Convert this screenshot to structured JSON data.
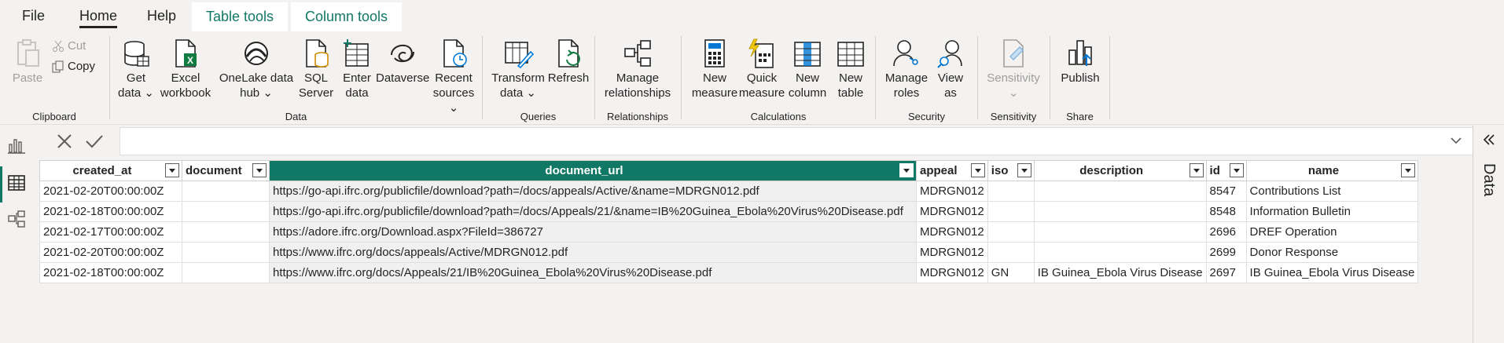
{
  "menu": {
    "file": "File",
    "home": "Home",
    "help": "Help",
    "table_tools": "Table tools",
    "column_tools": "Column tools"
  },
  "ribbon": {
    "clipboard": {
      "label": "Clipboard",
      "paste": "Paste",
      "cut": "Cut",
      "copy": "Copy"
    },
    "data": {
      "label": "Data",
      "get_data": [
        "Get",
        "data"
      ],
      "excel": [
        "Excel",
        "workbook"
      ],
      "onelake": [
        "OneLake data",
        "hub"
      ],
      "sql": [
        "SQL",
        "Server"
      ],
      "enter": [
        "Enter",
        "data"
      ],
      "dataverse": "Dataverse",
      "recent": [
        "Recent",
        "sources"
      ]
    },
    "queries": {
      "label": "Queries",
      "transform": [
        "Transform",
        "data"
      ],
      "refresh": "Refresh"
    },
    "relationships": {
      "label": "Relationships",
      "manage": [
        "Manage",
        "relationships"
      ]
    },
    "calculations": {
      "label": "Calculations",
      "new_measure": [
        "New",
        "measure"
      ],
      "quick_measure": [
        "Quick",
        "measure"
      ],
      "new_column": [
        "New",
        "column"
      ],
      "new_table": [
        "New",
        "table"
      ]
    },
    "security": {
      "label": "Security",
      "manage_roles": [
        "Manage",
        "roles"
      ],
      "view_as": [
        "View",
        "as"
      ]
    },
    "sensitivity": {
      "label": "Sensitivity",
      "sensitivity": "Sensitivity"
    },
    "share": {
      "label": "Share",
      "publish": "Publish"
    }
  },
  "right_pane": {
    "title": "Data"
  },
  "table": {
    "columns": [
      "created_at",
      "document",
      "document_url",
      "appeal",
      "iso",
      "description",
      "id",
      "name"
    ],
    "selected_column": "document_url",
    "rows": [
      [
        "2021-02-20T00:00:00Z",
        "",
        "https://go-api.ifrc.org/publicfile/download?path=/docs/appeals/Active/&name=MDRGN012.pdf",
        "MDRGN012",
        "",
        "",
        "8547",
        "Contributions List"
      ],
      [
        "2021-02-18T00:00:00Z",
        "",
        "https://go-api.ifrc.org/publicfile/download?path=/docs/Appeals/21/&name=IB%20Guinea_Ebola%20Virus%20Disease.pdf",
        "MDRGN012",
        "",
        "",
        "8548",
        "Information Bulletin"
      ],
      [
        "2021-02-17T00:00:00Z",
        "",
        "https://adore.ifrc.org/Download.aspx?FileId=386727",
        "MDRGN012",
        "",
        "",
        "2696",
        "DREF Operation"
      ],
      [
        "2021-02-20T00:00:00Z",
        "",
        "https://www.ifrc.org/docs/appeals/Active/MDRGN012.pdf",
        "MDRGN012",
        "",
        "",
        "2699",
        "Donor Response"
      ],
      [
        "2021-02-18T00:00:00Z",
        "",
        "https://www.ifrc.org/docs/Appeals/21/IB%20Guinea_Ebola%20Virus%20Disease.pdf",
        "MDRGN012",
        "GN",
        "IB Guinea_Ebola Virus Disease",
        "2697",
        "IB Guinea_Ebola Virus Disease"
      ]
    ]
  },
  "colors": {
    "accent": "#117865",
    "ribbon_bg": "#f3f2f1"
  }
}
